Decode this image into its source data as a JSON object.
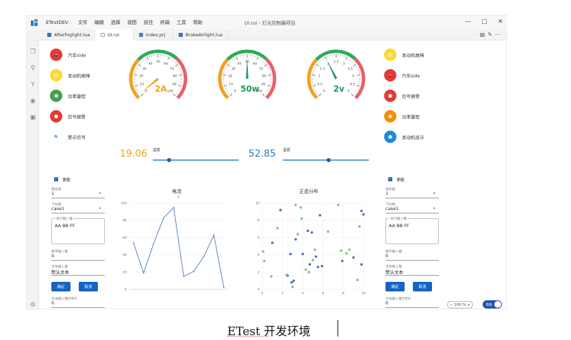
{
  "titlebar": {
    "app_name": "ETestDEV",
    "menu": [
      "文件",
      "编辑",
      "选择",
      "视图",
      "前往",
      "终端",
      "工具",
      "帮助"
    ],
    "window_title": "UI.rui - 灯光控制器项目",
    "controls": [
      "—",
      "▢",
      "✕"
    ]
  },
  "tabs": [
    {
      "label": "Afterfoglight.lua",
      "color": "#3f6fb4"
    },
    {
      "label": "UI.rui",
      "color": "#9e9e9e"
    },
    {
      "label": "index.prj",
      "color": "#5b7fb8"
    },
    {
      "label": "BrakeAirlight.lua",
      "color": "#3f6fb4"
    }
  ],
  "left_indicators": [
    {
      "label": "汽车side",
      "color": "#e53935",
      "icon": "car-icon"
    },
    {
      "label": "发动机故障",
      "color": "#fdd835",
      "icon": "engine-icon"
    },
    {
      "label": "功率量程",
      "color": "#43a047",
      "icon": "power-icon"
    },
    {
      "label": "信号报警",
      "color": "#e53935",
      "icon": "signal-icon"
    },
    {
      "label": "警示信号",
      "color": "#ffffff",
      "icon": "warning-icon"
    }
  ],
  "right_indicators": [
    {
      "label": "发动机故障",
      "color": "#fdd835",
      "icon": "engine-icon"
    },
    {
      "label": "汽车side",
      "color": "#e53935",
      "icon": "car-icon"
    },
    {
      "label": "信号报警",
      "color": "#e53935",
      "icon": "signal-icon"
    },
    {
      "label": "功率量程",
      "color": "#fb8c00",
      "icon": "power-icon"
    },
    {
      "label": "发动机显示",
      "color": "#1e88e5",
      "icon": "engine-icon"
    }
  ],
  "gauges": [
    {
      "value_label": "2A",
      "value": 2,
      "max": 100,
      "ticks": [
        "0",
        "10",
        "20",
        "30",
        "40",
        "50",
        "60",
        "70",
        "80",
        "90",
        "100"
      ],
      "value_color": "#f0a020",
      "needle_color": "#f0a020"
    },
    {
      "value_label": "50w",
      "value": 50,
      "max": 100,
      "ticks": [
        "0",
        "10",
        "20",
        "30",
        "40",
        "50",
        "60",
        "70",
        "80",
        "90",
        "100"
      ],
      "value_color": "#1e9c5a",
      "needle_color": "#1e9c5a"
    },
    {
      "value_label": "2v",
      "value": 2,
      "max": 5,
      "ticks": [
        "0",
        "0.5",
        "1",
        "1.5",
        "2",
        "2.5",
        "3",
        "3.5",
        "4",
        "4.5",
        "5"
      ],
      "value_color": "#1e9c5a",
      "needle_color": "#1e9c5a"
    }
  ],
  "sliders": [
    {
      "value": "19.06",
      "label": "温度",
      "value_color": "#f0a020",
      "fraction": 0.19
    },
    {
      "value": "52.85",
      "label": "温度",
      "value_color": "#2b7bbf",
      "fraction": 0.53
    }
  ],
  "form_left": {
    "enable_label": "使能",
    "combo_label": "组合框",
    "combo_value": "1",
    "dropdown_label": "下拉框",
    "dropdown_value": "case1",
    "multiline_label": "多行输入框",
    "multiline_value": "AA BB FF",
    "number_label": "数字输入框",
    "number_value": "0",
    "text_label": "文本输入框",
    "text_value": "默认文本",
    "ok_label": "确定",
    "cancel_label": "取消",
    "hex_label": "文本输入框(HEX)",
    "hex_value": "0"
  },
  "form_right": {
    "enable_label": "使能",
    "combo_label": "组合框",
    "combo_value": "1",
    "dropdown_label": "下拉框",
    "dropdown_value": "case1",
    "multiline_label": "多行输入框",
    "multiline_value": "AA BB FF",
    "number_label": "数字输入框",
    "number_value": "0",
    "text_label": "文本输入框",
    "text_value": "默认文本",
    "ok_label": "确定",
    "cancel_label": "取消",
    "hex_label": "文本输入框(HEX)",
    "hex_value": "0"
  },
  "chart_data": [
    {
      "type": "line",
      "title": "电流",
      "subtitle": "2",
      "x": [
        0,
        1,
        2,
        3,
        4,
        5,
        6,
        7,
        8,
        9
      ],
      "values": [
        54,
        19,
        53,
        83,
        95,
        15,
        21,
        38,
        63,
        2
      ],
      "ylim": [
        0,
        100
      ],
      "yticks": [
        "0",
        "20",
        "40",
        "60",
        "80",
        "100"
      ],
      "color": "#5b7fc0"
    },
    {
      "type": "scatter",
      "title": "正态分布",
      "xlim": [
        0,
        10
      ],
      "ylim": [
        0,
        10
      ],
      "xticks": [
        "0",
        "2",
        "4",
        "6",
        "8",
        "10"
      ],
      "yticks": [
        "0",
        "2",
        "4",
        "6",
        "8",
        "10"
      ],
      "series": [
        {
          "color": "#4a6fb5",
          "points": [
            [
              1.0,
              5.4
            ],
            [
              1.8,
              9.2
            ],
            [
              2.5,
              1.6
            ],
            [
              2.8,
              4.1
            ],
            [
              2.9,
              0.8
            ],
            [
              3.3,
              5.8
            ],
            [
              3.1,
              1.0
            ],
            [
              4.0,
              4.1
            ],
            [
              4.5,
              6.8
            ],
            [
              4.7,
              2.9
            ],
            [
              4.9,
              6.6
            ],
            [
              5.3,
              3.8
            ],
            [
              5.5,
              2.6
            ],
            [
              5.7,
              8.6
            ],
            [
              5.9,
              2.7
            ],
            [
              7.9,
              3.3
            ],
            [
              9.0,
              3.7
            ],
            [
              9.8,
              9.1
            ],
            [
              10.0,
              8.7
            ],
            [
              9.8,
              2.9
            ]
          ]
        },
        {
          "color": "#7cc576",
          "points": [
            [
              0.1,
              4.4
            ],
            [
              0.2,
              3.3
            ],
            [
              0.9,
              1.5
            ],
            [
              1.5,
              7.1
            ],
            [
              2.4,
              1.7
            ],
            [
              3.0,
              0.3
            ],
            [
              3.3,
              9.8
            ],
            [
              3.5,
              6.4
            ],
            [
              3.8,
              9.5
            ],
            [
              3.9,
              8.2
            ],
            [
              4.3,
              2.3
            ],
            [
              4.6,
              2.0
            ],
            [
              5.0,
              3.4
            ],
            [
              5.2,
              4.6
            ],
            [
              6.5,
              6.7
            ],
            [
              7.5,
              9.8
            ],
            [
              7.8,
              4.5
            ],
            [
              8.3,
              4.2
            ],
            [
              8.6,
              4.6
            ],
            [
              9.4,
              1.1
            ],
            [
              9.6,
              7.3
            ]
          ]
        }
      ]
    }
  ],
  "bottom_bar": {
    "zoom_label": "100 %",
    "zoom_minus": "−",
    "zoom_plus": "+",
    "theme_label": "浅色"
  },
  "caption": "ETest 开发环境"
}
